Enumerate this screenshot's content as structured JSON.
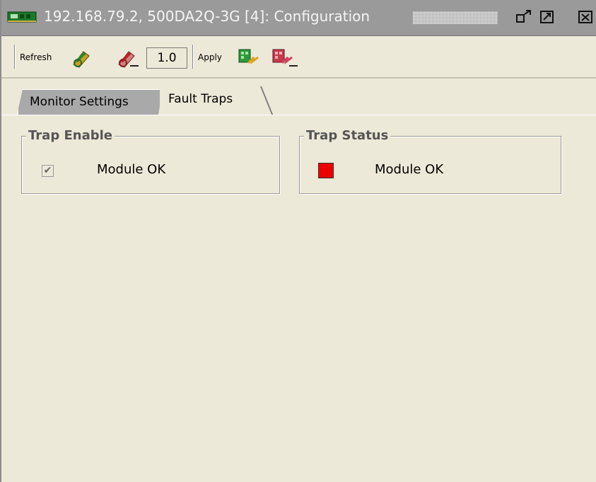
{
  "window": {
    "title": "192.168.79.2, 500DA2Q-3G  [4]: Configuration"
  },
  "title_buttons": [
    "undock-icon",
    "maximize-icon",
    "close-icon"
  ],
  "toolbar": {
    "refresh_label": "Refresh",
    "refresh_icons": [
      "refresh-green-icon",
      "refresh-red-icon"
    ],
    "version_value": "1.0",
    "apply_label": "Apply",
    "apply_icons": [
      "apply-green-icon",
      "apply-red-icon"
    ]
  },
  "tabs": [
    {
      "label": "Monitor Settings",
      "active": false
    },
    {
      "label": "Fault Traps",
      "active": true
    }
  ],
  "trap_enable": {
    "title": "Trap Enable",
    "items": [
      {
        "label": "Module OK",
        "checked": true
      }
    ]
  },
  "trap_status": {
    "title": "Trap Status",
    "items": [
      {
        "label": "Module OK",
        "status_color": "#ee0000"
      }
    ]
  },
  "colors": {
    "panel_bg": "#ece9d8",
    "titlebar_bg": "#9a9a9a",
    "inactive_tab": "#a9a9a9",
    "status_red": "#ee0000"
  }
}
